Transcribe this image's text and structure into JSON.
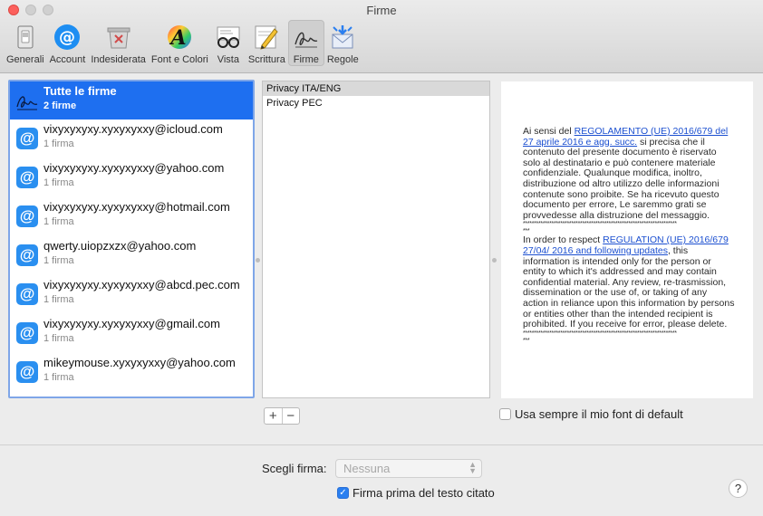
{
  "window": {
    "title": "Firme"
  },
  "toolbar": {
    "items": [
      {
        "label": "Generali",
        "icon": "switch-icon"
      },
      {
        "label": "Account",
        "icon": "at-icon"
      },
      {
        "label": "Indesiderata",
        "icon": "junk-icon"
      },
      {
        "label": "Font e Colori",
        "icon": "font-colors-icon"
      },
      {
        "label": "Vista",
        "icon": "glasses-icon"
      },
      {
        "label": "Scrittura",
        "icon": "pencil-icon"
      },
      {
        "label": "Firme",
        "icon": "signature-icon"
      },
      {
        "label": "Regole",
        "icon": "rules-icon"
      }
    ],
    "active": "Firme"
  },
  "accounts": [
    {
      "title": "Tutte le firme",
      "sub": "2 firme"
    },
    {
      "title": "vixyxyxyxy.xyxyxyxxy@icloud.com",
      "sub": "1 firma"
    },
    {
      "title": "vixyxyxyxy.xyxyxyxxy@yahoo.com",
      "sub": "1 firma"
    },
    {
      "title": "vixyxyxyxy.xyxyxyxxy@hotmail.com",
      "sub": "1 firma"
    },
    {
      "title": "qwerty.uiopzxzx@yahoo.com",
      "sub": "1 firma"
    },
    {
      "title": "vixyxyxyxy.xyxyxyxxy@abcd.pec.com",
      "sub": "1 firma"
    },
    {
      "title": "vixyxyxyxy.xyxyxyxxy@gmail.com",
      "sub": "1 firma"
    },
    {
      "title": "mikeymouse.xyxyxyxxy@yahoo.com",
      "sub": "1 firma"
    }
  ],
  "signatures": [
    "Privacy ITA/ENG",
    "Privacy PEC"
  ],
  "preview": {
    "it_prefix": "Ai sensi del ",
    "it_link": "REGOLAMENTO (UE) 2016/679 del 27 aprile 2016 e agg. succ.",
    "it_body": " si precisa che il contenuto del presente documento è riservato solo al destinatario e può contenere materiale confidenziale. Qualunque modifica, inoltro, distribuzione od altro utilizzo delle informazioni contenute sono proibite. Se ha ricevuto questo documento per errore, Le saremmo grati se provvedesse alla distruzione del messaggio.",
    "stars": "**********************************************************************",
    "stars_end": "***",
    "en_prefix": "In order to respect ",
    "en_link": "REGULATION (UE) 2016/679 27/04/ 2016 and following updates",
    "en_body": ", this information is intended only for the person or entity to which it's addressed and may contain confidential material. Any review, re-trasmission, dissemination or the use of, or taking of any action in reliance upon this information by persons or entities other than the intended recipient is prohibited. If you receive for error, please delete."
  },
  "controls": {
    "plus": "+",
    "minus": "−",
    "default_font_label": "Usa sempre il mio font di default",
    "choose_label": "Scegli firma:",
    "choose_value": "Nessuna",
    "above_quote_label": "Firma prima del testo citato",
    "help": "?"
  },
  "colors": {
    "selection": "#1e6ff0",
    "accent": "#2a8ff0",
    "link": "#1b4fd0"
  }
}
